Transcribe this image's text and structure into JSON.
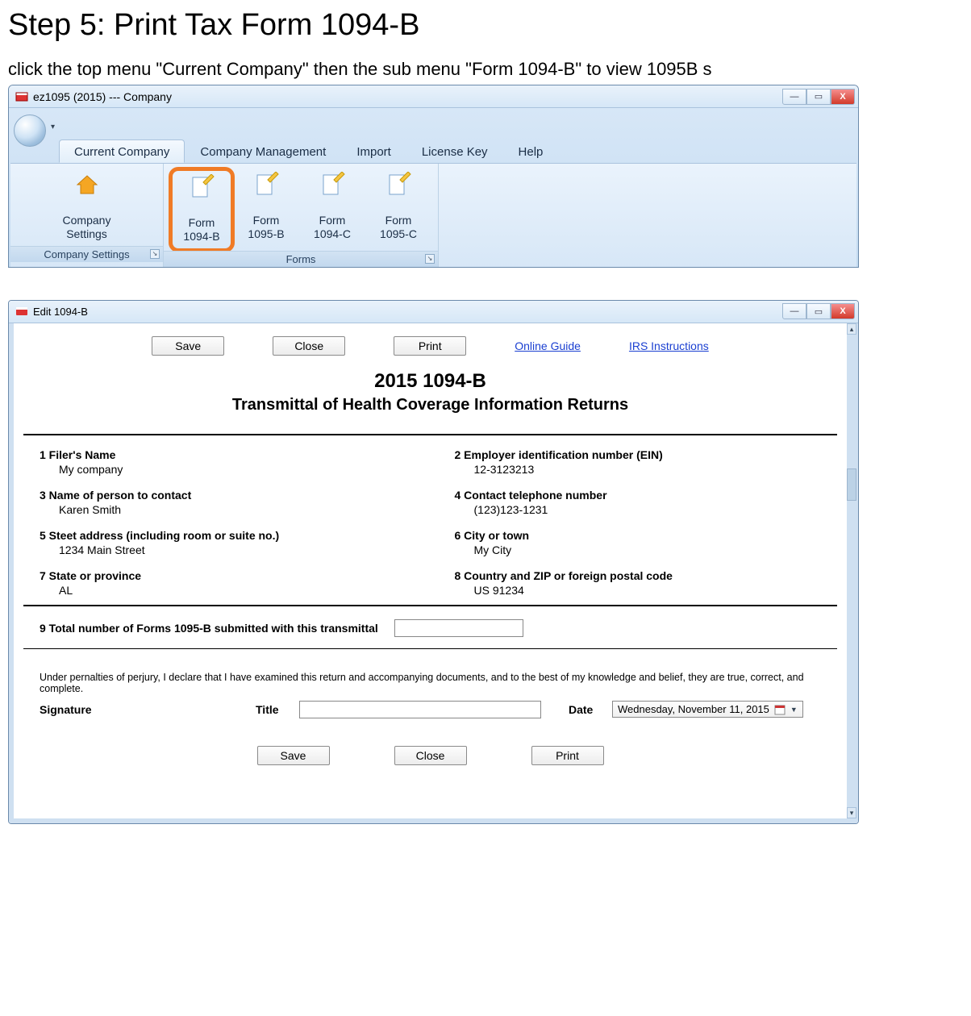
{
  "page": {
    "heading": "Step 5: Print Tax Form 1094-B",
    "instruction": "click the top menu \"Current Company\" then the sub menu \"Form 1094-B\" to view 1095B s"
  },
  "win1": {
    "title": "ez1095 (2015) --- Company",
    "tabs": {
      "current_company": "Current Company",
      "company_management": "Company Management",
      "import": "Import",
      "license_key": "License Key",
      "help": "Help"
    },
    "groups": {
      "settings": {
        "company_settings": "Company\nSettings",
        "label": "Company Settings"
      },
      "forms": {
        "f1094b": "Form\n1094-B",
        "f1095b": "Form\n1095-B",
        "f1094c": "Form\n1094-C",
        "f1095c": "Form\n1095-C",
        "label": "Forms"
      }
    }
  },
  "win2": {
    "title": "Edit 1094-B",
    "buttons": {
      "save": "Save",
      "close": "Close",
      "print": "Print"
    },
    "links": {
      "online_guide": "Online Guide",
      "irs": "IRS Instructions"
    },
    "form": {
      "title": "2015 1094-B",
      "subtitle": "Transmittal of Health Coverage Information Returns",
      "f1_label": "1 Filer's Name",
      "f1_value": "My company",
      "f2_label": "2 Employer identification number (EIN)",
      "f2_value": "12-3123213",
      "f3_label": "3 Name of person to contact",
      "f3_value": "Karen  Smith",
      "f4_label": "4 Contact telephone number",
      "f4_value": "(123)123-1231",
      "f5_label": "5 Steet address (including room or suite no.)",
      "f5_value": "1234 Main Street",
      "f6_label": "6 City or town",
      "f6_value": "My City",
      "f7_label": "7 State or province",
      "f7_value": "AL",
      "f8_label": "8 Country and ZIP or foreign postal code",
      "f8_value": "US 91234",
      "f9_label": "9 Total number of Forms 1095-B submitted with this transmittal",
      "perjury": "Under pernalties of perjury, I declare that I have examined this return and accompanying documents, and to the best of my knowledge and belief, they are true, correct, and complete.",
      "sig_label": "Signature",
      "title_label": "Title",
      "date_label": "Date",
      "date_value": "Wednesday, November 11, 2015"
    }
  }
}
